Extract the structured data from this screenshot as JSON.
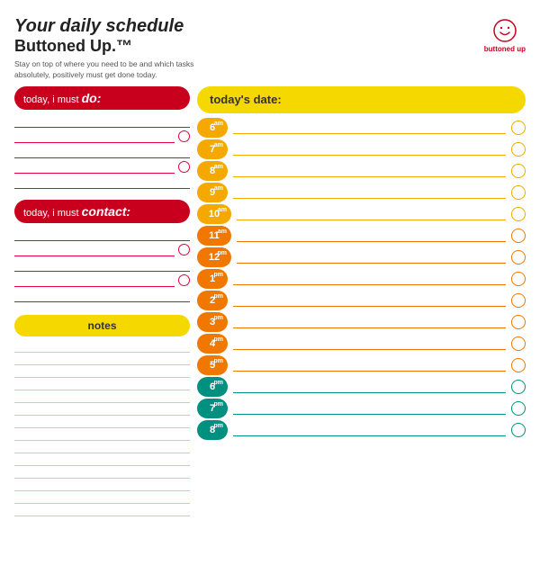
{
  "header": {
    "title_your": "Your ",
    "title_daily": "daily schedule",
    "title_buttoned": "Buttoned Up.™",
    "subtitle": "Stay on top of where you need to be and which tasks absolutely, positively must get done today.",
    "date_label": "today's date:",
    "logo_text": "buttoned up"
  },
  "left": {
    "do_btn": "today, i must do:",
    "contact_btn": "today, i must contact:",
    "notes_btn": "notes",
    "do_lines": 5,
    "contact_lines": 5,
    "notes_lines": 14
  },
  "schedule": {
    "rows": [
      {
        "time": "6",
        "suffix": "am",
        "color": "yellow"
      },
      {
        "time": "7",
        "suffix": "am",
        "color": "yellow"
      },
      {
        "time": "8",
        "suffix": "am",
        "color": "yellow"
      },
      {
        "time": "9",
        "suffix": "am",
        "color": "yellow"
      },
      {
        "time": "10",
        "suffix": "am",
        "color": "yellow"
      },
      {
        "time": "11",
        "suffix": "am",
        "color": "orange"
      },
      {
        "time": "12",
        "suffix": "pm",
        "color": "orange"
      },
      {
        "time": "1",
        "suffix": "pm",
        "color": "orange"
      },
      {
        "time": "2",
        "suffix": "pm",
        "color": "orange"
      },
      {
        "time": "3",
        "suffix": "pm",
        "color": "orange"
      },
      {
        "time": "4",
        "suffix": "pm",
        "color": "orange"
      },
      {
        "time": "5",
        "suffix": "pm",
        "color": "orange"
      },
      {
        "time": "6",
        "suffix": "pm",
        "color": "teal"
      },
      {
        "time": "7",
        "suffix": "pm",
        "color": "teal"
      },
      {
        "time": "8",
        "suffix": "pm",
        "color": "teal"
      }
    ]
  },
  "colors": {
    "yellow": "#f5a800",
    "orange": "#f07800",
    "red": "#e8003a",
    "teal": "#009080",
    "pink": "#e8003a",
    "gold": "#f5d800"
  }
}
